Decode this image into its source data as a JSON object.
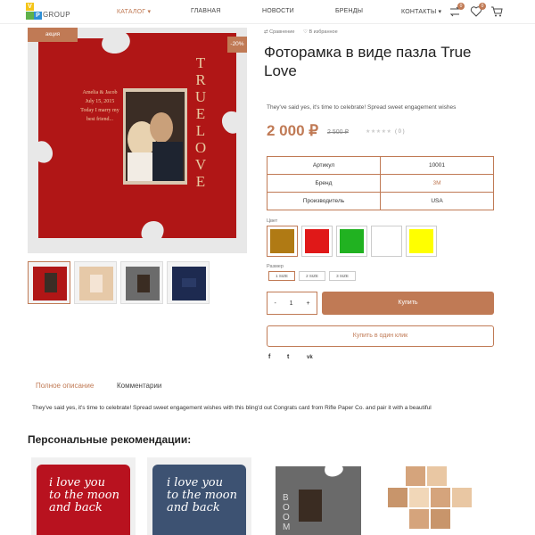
{
  "logo": {
    "letters": [
      "V",
      "P"
    ],
    "text": "GROUP"
  },
  "nav": {
    "items": [
      "КАТАЛОГ",
      "ГЛАВНАЯ",
      "НОВОСТИ",
      "БРЕНДЫ",
      "КОНТАКТЫ"
    ],
    "badge_compare": "0",
    "badge_fav": "0"
  },
  "product": {
    "sale_tag": "акция",
    "discount": "-20%",
    "compare": "Сравнение",
    "favorite": "В избранное",
    "title": "Фоторамка в виде пазла True Love",
    "short_desc": "They've said yes, it's time to celebrate! Spread sweet engagement wishes",
    "price": "2 000 ₽",
    "old_price": "2 500 ₽",
    "stars": "★★★★★",
    "reviews": "( 0 )",
    "image_text": {
      "true_love": "TRUE LOVE",
      "line1": "Amelia & Jacob",
      "line2": "July 15, 2015",
      "line3": "Today I marry my",
      "line4": "best friend..."
    }
  },
  "props": [
    {
      "k": "Артикул",
      "v": "10001"
    },
    {
      "k": "Бренд",
      "v": "3M"
    },
    {
      "k": "Производитель",
      "v": "USA"
    }
  ],
  "color_label": "Цвет",
  "colors": [
    "#b07a14",
    "#e01818",
    "#21b221",
    "#ffffff",
    "#ffff00"
  ],
  "size_label": "Размер",
  "sizes": [
    "1 SIZE",
    "2 SIZE",
    "3 SIZE"
  ],
  "qty": {
    "minus": "-",
    "value": "1",
    "plus": "+"
  },
  "buy_label": "Купить",
  "one_click_label": "Купить в один клик",
  "share": [
    "f",
    "t",
    "vk"
  ],
  "tabs": [
    "Полное описание",
    "Комментарии"
  ],
  "full_desc": "They've said yes, it's time to celebrate! Spread sweet engagement wishes with this bling'd out Congrats card from Rifle Paper Co. and pair it with a beautiful",
  "recommend_title": "Персональные рекомендации:",
  "rec_text": {
    "pillow_text": "i love you to the moon and back",
    "boom": "BOOM"
  }
}
